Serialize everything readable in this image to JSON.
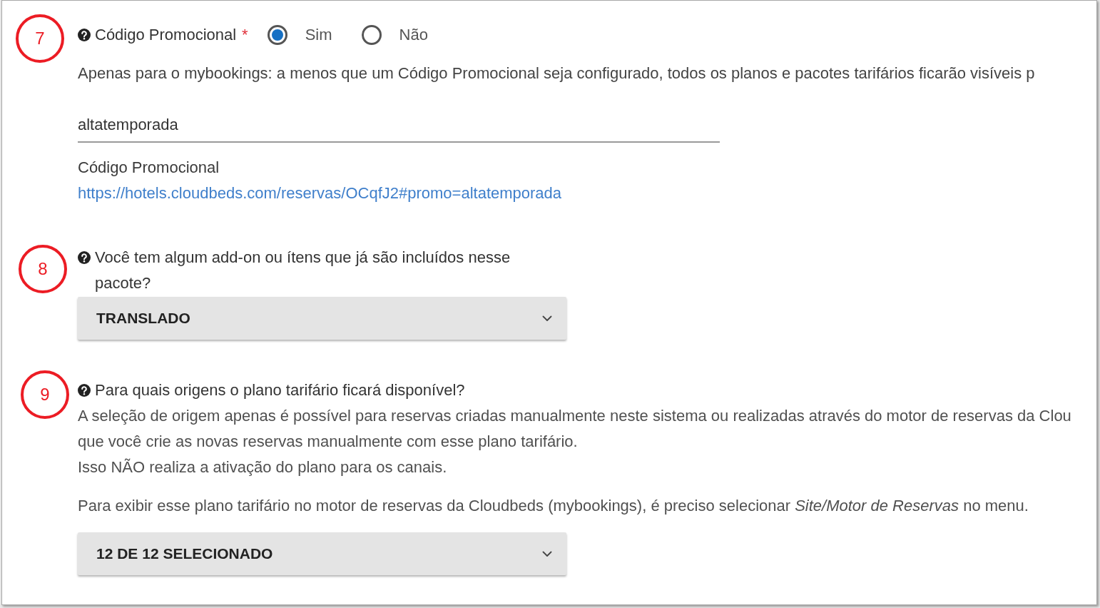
{
  "sections": [
    {
      "marker": "7",
      "label": "Código Promocional",
      "required_mark": "*",
      "options": [
        {
          "label": "Sim",
          "selected": true
        },
        {
          "label": "Não",
          "selected": false
        }
      ],
      "description": "Apenas para o mybookings: a menos que um Código Promocional seja configurado, todos os planos e pacotes tarifários ficarão visíveis p",
      "field": {
        "value": "altatemporada"
      },
      "link_title": "Código Promocional",
      "link": "https://hotels.cloudbeds.com/reservas/OCqfJ2#promo=altatemporada"
    },
    {
      "marker": "8",
      "label": "Você tem algum add-on ou ítens que já são incluídos nesse pacote?",
      "select": {
        "value": "TRANSLADO"
      }
    },
    {
      "marker": "9",
      "label": "Para quais origens o plano tarifário ficará disponível?",
      "description_lines": [
        "A seleção de origem apenas é possível para reservas criadas manualmente neste sistema ou realizadas através do motor de reservas da Clou",
        "que você crie as novas reservas manualmente com esse plano tarifário.",
        "Isso NÃO realiza a ativação do plano para os canais."
      ],
      "note": "Para exibir esse plano tarifário no motor de reservas da Cloudbeds (mybookings), é preciso selecionar *Site/Motor de Reservas* no menu.",
      "select": {
        "value": "12 DE 12 SELECIONADO"
      }
    }
  ]
}
